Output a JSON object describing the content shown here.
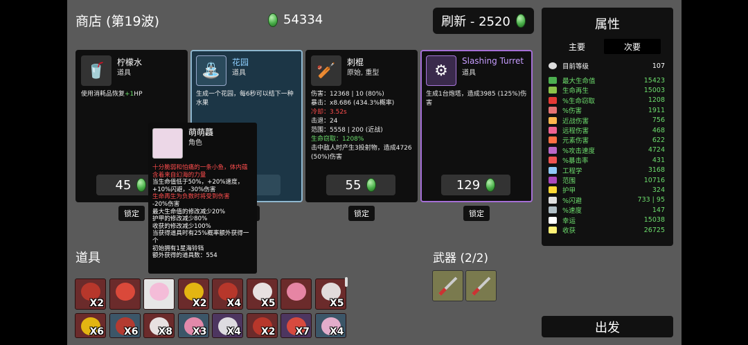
{
  "shop": {
    "title": "商店 (第19波)",
    "money": "54334",
    "refresh_label": "刷新 - 2520"
  },
  "cards": [
    {
      "name": "柠檬水",
      "type": "道具",
      "desc_pre": "使用消耗品恢复",
      "desc_hl": "+1",
      "desc_post": "HP",
      "price": "45",
      "lock": "锁定"
    },
    {
      "name": "花园",
      "type": "道具",
      "desc": "生成一个花园，每6秒可以结下一种水果",
      "price": "",
      "lock": "锁定"
    },
    {
      "name": "刺棍",
      "type": "原始, 重型",
      "stats": [
        "伤害：12368 | 10 (80%)",
        "暴击：x8.686 (434.3%概率)",
        "冷却：3.52s",
        "击退：24",
        "范围：5558 | 200 (近战)",
        "生命窃取：1208%",
        "击中敌人时产生3投射物，造成4726 (50%)伤害"
      ],
      "price": "55",
      "lock": "锁定"
    },
    {
      "name": "Slashing Turret",
      "type": "道具",
      "desc": "生成1台炮塔，造成3985 (125%)伤害",
      "price": "129",
      "lock": "锁定"
    }
  ],
  "tooltip": {
    "name": "萌萌龘",
    "type": "角色",
    "lines": [
      "十分脆弱和怕痛的一条小鱼，体内蕴含着来自幻海的力量",
      "当生命值低于50%，+20%速度，+10%闪避，-30%伤害",
      "生命再生为负数时将受到伤害",
      "-20%伤害",
      "最大生命值的修改减少20%",
      "护甲的修改减少80%",
      "收获的修改减少100%",
      "当获得道具时有25%概率额外获得一个",
      "初始拥有1星海铃铛",
      "额外获得的道具数：554"
    ]
  },
  "stats": {
    "title": "属性",
    "tab_primary": "主要",
    "tab_secondary": "次要",
    "level_label": "目前等级",
    "level_value": "107",
    "rows": [
      {
        "label": "最大生命值",
        "value": "15423",
        "color": "#6dde6d",
        "icon_color": "#4caf50"
      },
      {
        "label": "生命再生",
        "value": "15003",
        "color": "#6dde6d",
        "icon_color": "#8bc34a"
      },
      {
        "label": "%生命窃取",
        "value": "1208",
        "color": "#6dde6d",
        "icon_color": "#e53935"
      },
      {
        "label": "%伤害",
        "value": "1911",
        "color": "#6dde6d",
        "icon_color": "#e57373"
      },
      {
        "label": "近战伤害",
        "value": "756",
        "color": "#6dde6d",
        "icon_color": "#ffb74d"
      },
      {
        "label": "远程伤害",
        "value": "468",
        "color": "#6dde6d",
        "icon_color": "#f06292"
      },
      {
        "label": "元素伤害",
        "value": "622",
        "color": "#6dde6d",
        "icon_color": "#ff7043"
      },
      {
        "label": "%攻击速度",
        "value": "4724",
        "color": "#6dde6d",
        "icon_color": "#ba68c8"
      },
      {
        "label": "%暴击率",
        "value": "431",
        "color": "#6dde6d",
        "icon_color": "#ef5350"
      },
      {
        "label": "工程学",
        "value": "3168",
        "color": "#6dde6d",
        "icon_color": "#90caf9"
      },
      {
        "label": "范围",
        "value": "10716",
        "color": "#6dde6d",
        "icon_color": "#ab47bc"
      },
      {
        "label": "护甲",
        "value": "324",
        "color": "#6dde6d",
        "icon_color": "#fdd835"
      },
      {
        "label": "%闪避",
        "value": "733 | 95",
        "color": "#6dde6d",
        "icon_color": "#e0e0e0"
      },
      {
        "label": "%速度",
        "value": "147",
        "color": "#6dde6d",
        "icon_color": "#b0bec5"
      },
      {
        "label": "幸运",
        "value": "15038",
        "color": "#6dde6d",
        "icon_color": "#ffffff"
      },
      {
        "label": "收获",
        "value": "26725",
        "color": "#6dde6d",
        "icon_color": "#fff176"
      }
    ]
  },
  "items": {
    "title": "道具",
    "row1": [
      {
        "count": "X2",
        "cls": ""
      },
      {
        "count": "",
        "cls": ""
      },
      {
        "count": "",
        "cls": "white"
      },
      {
        "count": "X2",
        "cls": ""
      },
      {
        "count": "X4",
        "cls": ""
      },
      {
        "count": "X5",
        "cls": ""
      },
      {
        "count": "",
        "cls": ""
      },
      {
        "count": "X5",
        "cls": ""
      }
    ],
    "row2": [
      {
        "count": "X6",
        "cls": ""
      },
      {
        "count": "X6",
        "cls": "blue"
      },
      {
        "count": "X8",
        "cls": ""
      },
      {
        "count": "X3",
        "cls": "blue"
      },
      {
        "count": "X4",
        "cls": "purple"
      },
      {
        "count": "X2",
        "cls": ""
      },
      {
        "count": "X7",
        "cls": "purple"
      },
      {
        "count": "X4",
        "cls": "blue"
      }
    ]
  },
  "weapons": {
    "title": "武器 (2/2)"
  },
  "go_label": "出发"
}
